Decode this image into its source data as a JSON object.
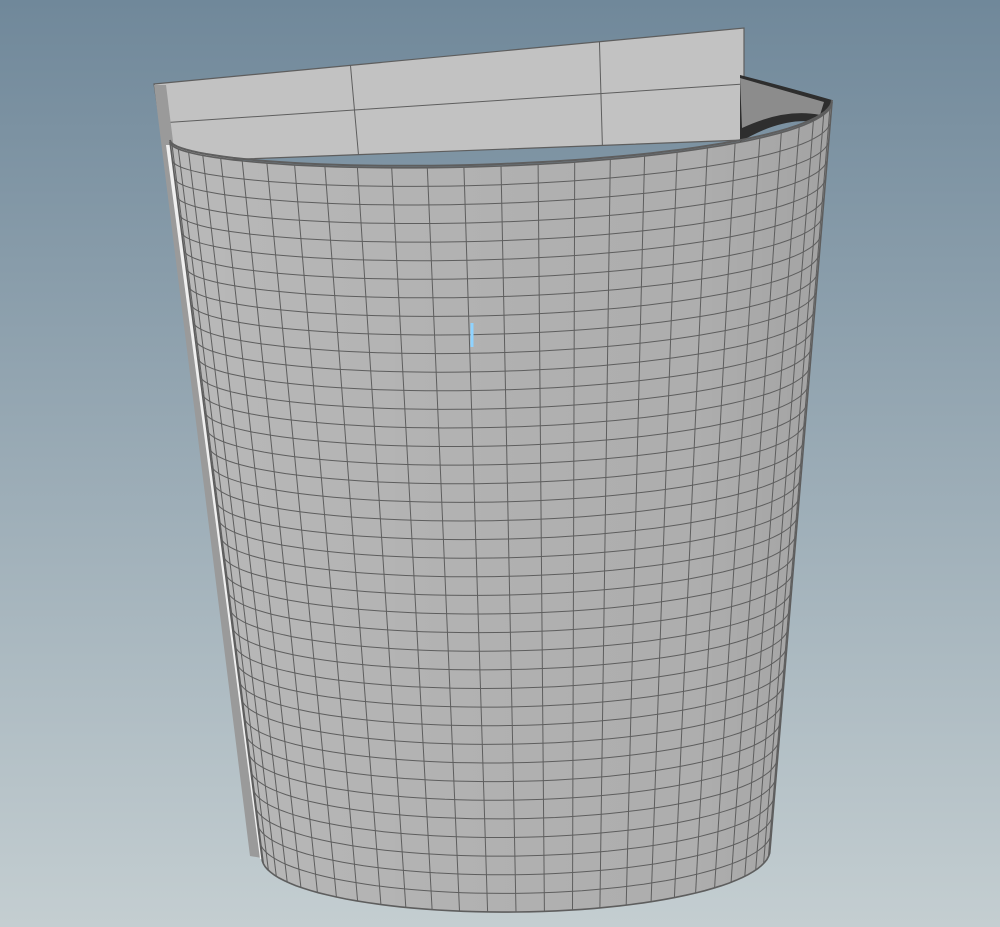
{
  "viewport": {
    "background_top_color": "#70889a",
    "background_bottom_color": "#c4ced1"
  },
  "model": {
    "name": "half-cylinder-shell",
    "surface_color": "#b4b4b4",
    "wireframe_color": "#5e5e5e",
    "back_panel": {
      "surface_color": "#c2c2c2",
      "columns": 3,
      "rows": 2
    },
    "curved_wall": {
      "surface_color": "#b1b1b1",
      "columns": 28,
      "rows": 40
    },
    "selected_edge_color": "#8fd3ff"
  }
}
